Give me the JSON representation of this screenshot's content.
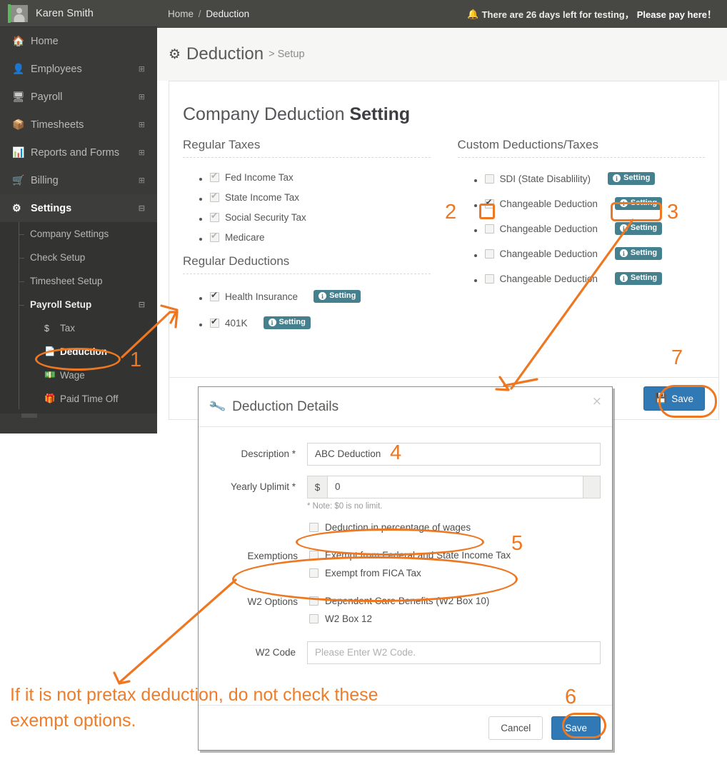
{
  "sidebar": {
    "user": {
      "name": "Karen Smith",
      "avatar_icon": "user-avatar-icon",
      "accent_color": "#5cb85c"
    },
    "items": [
      {
        "label": "Home",
        "icon": "home-icon",
        "expander": ""
      },
      {
        "label": "Employees",
        "icon": "user-icon",
        "expander": "⊞"
      },
      {
        "label": "Payroll",
        "icon": "monitor-icon",
        "expander": "⊞"
      },
      {
        "label": "Timesheets",
        "icon": "inbox-icon",
        "expander": "⊞"
      },
      {
        "label": "Reports and Forms",
        "icon": "bar-chart-icon",
        "expander": "⊞"
      },
      {
        "label": "Billing",
        "icon": "cart-icon",
        "expander": "⊞"
      },
      {
        "label": "Settings",
        "icon": "gears-icon",
        "expander": "⊟"
      }
    ],
    "submenu": [
      {
        "label": "Company Settings",
        "expander": ""
      },
      {
        "label": "Check Setup",
        "expander": ""
      },
      {
        "label": "Timesheet Setup",
        "expander": ""
      },
      {
        "label": "Payroll Setup",
        "expander": "⊟"
      }
    ],
    "submenu2": [
      {
        "label": "Tax",
        "icon": "dollar-icon"
      },
      {
        "label": "Deduction",
        "icon": "document-icon"
      },
      {
        "label": "Wage",
        "icon": "money-icon"
      },
      {
        "label": "Paid Time Off",
        "icon": "gift-icon"
      }
    ]
  },
  "topbar": {
    "breadcrumb_home": "Home",
    "breadcrumb_sep": "/",
    "breadcrumb_current": "Deduction",
    "notice_bell": "🔔",
    "notice_text": "There are 26 days left for testing，",
    "notice_link": "Please pay here！"
  },
  "pagehead": {
    "gear_icon": "gear-icon",
    "title": "Deduction",
    "subtitle": "> Setup"
  },
  "card": {
    "title_light": "Company Deduction ",
    "title_bold": "Setting",
    "left": {
      "section1": "Regular Taxes",
      "taxes": [
        {
          "label": "Fed Income Tax",
          "checked": true,
          "style": "light"
        },
        {
          "label": "State Income Tax",
          "checked": true,
          "style": "light"
        },
        {
          "label": "Social Security Tax",
          "checked": true,
          "style": "light"
        },
        {
          "label": "Medicare",
          "checked": true,
          "style": "light"
        }
      ],
      "section2": "Regular Deductions",
      "deductions": [
        {
          "label": "Health Insurance",
          "checked": true,
          "style": "dark",
          "badge": "Setting"
        },
        {
          "label": "401K",
          "checked": true,
          "style": "dark",
          "badge": "Setting"
        }
      ]
    },
    "right": {
      "section1": "Custom Deductions/Taxes",
      "items": [
        {
          "label": "SDI (State Disablility)",
          "checked": false,
          "badge": "Setting"
        },
        {
          "label": "Changeable Deduction",
          "checked": true,
          "badge": "Setting"
        },
        {
          "label": "Changeable Deduction",
          "checked": false,
          "badge": "Setting"
        },
        {
          "label": "Changeable Deduction",
          "checked": false,
          "badge": "Setting"
        },
        {
          "label": "Changeable Deduction",
          "checked": false,
          "badge": "Setting"
        }
      ]
    },
    "save_label": "Save",
    "save_icon": "floppy-disk-icon"
  },
  "modal": {
    "icon": "wrench-icon",
    "title": "Deduction Details",
    "close": "×",
    "fields": {
      "description_label": "Description *",
      "description_value": "ABC Deduction",
      "uplimit_label": "Yearly Uplimit *",
      "uplimit_prefix": "$",
      "uplimit_value": "0",
      "uplimit_note": "* Note: $0 is no limit.",
      "percentage_label": "Deduction in percentage of wages",
      "percentage_checked": false,
      "exemptions_label": "Exemptions",
      "exemptions": [
        {
          "label": "Exempt from Federal and State Income Tax",
          "checked": false
        },
        {
          "label": "Exempt from FICA Tax",
          "checked": false
        }
      ],
      "w2_options_label": "W2 Options",
      "w2_options": [
        {
          "label": "Dependent Care Benefits (W2 Box 10)",
          "checked": false
        },
        {
          "label": "W2 Box 12",
          "checked": false
        }
      ],
      "w2_code_label": "W2 Code",
      "w2_code_placeholder": "Please Enter W2 Code."
    },
    "cancel_label": "Cancel",
    "save_label": "Save"
  },
  "annotations": {
    "color": "#ee7722",
    "numbers": [
      "1",
      "2",
      "3",
      "4",
      "5",
      "6",
      "7"
    ],
    "note": "If it is not pretax deduction, do not check these exempt options."
  }
}
